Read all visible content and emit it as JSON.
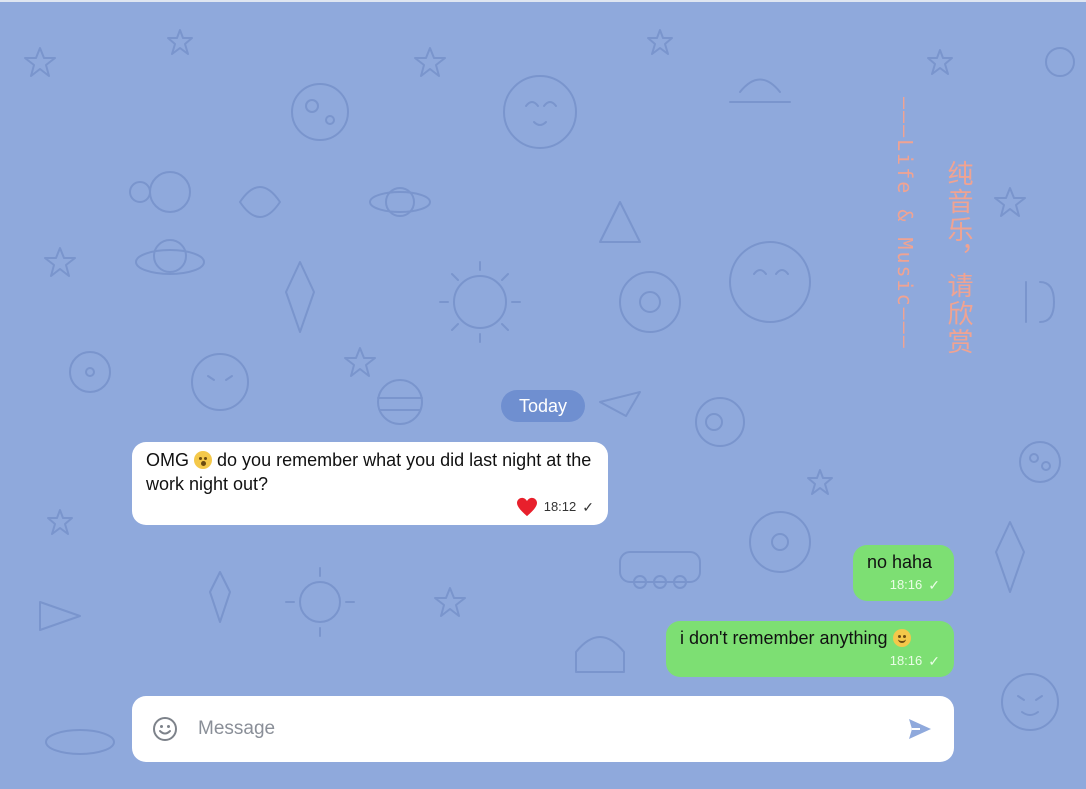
{
  "chat": {
    "date_label": "Today",
    "messages": [
      {
        "direction": "incoming",
        "text_before": "OMG",
        "text_after": "do you remember what you did last night at the work night out?",
        "emoji": "astonished-face",
        "reaction": "red-heart",
        "time": "18:12",
        "status": "✓"
      },
      {
        "direction": "outgoing",
        "text": "no haha",
        "time": "18:16",
        "status": "✓"
      },
      {
        "direction": "outgoing",
        "text": "i don't remember anything",
        "emoji": "grinning-face",
        "time": "18:16",
        "status": "✓"
      }
    ]
  },
  "composer": {
    "placeholder": "Message",
    "value": ""
  },
  "overlay": {
    "vertical_text_en": "———Life & Music———",
    "vertical_text_cn": "纯音乐，请欣赏"
  },
  "colors": {
    "background": "#8fa9dc",
    "pattern": "#7a95cd",
    "date_pill": "#6f8fd0",
    "incoming_bubble": "#ffffff",
    "outgoing_bubble": "#7ddf73",
    "heart": "#e8202c",
    "overlay_text": "#f0a392",
    "send_icon": "#8fa9dc"
  }
}
